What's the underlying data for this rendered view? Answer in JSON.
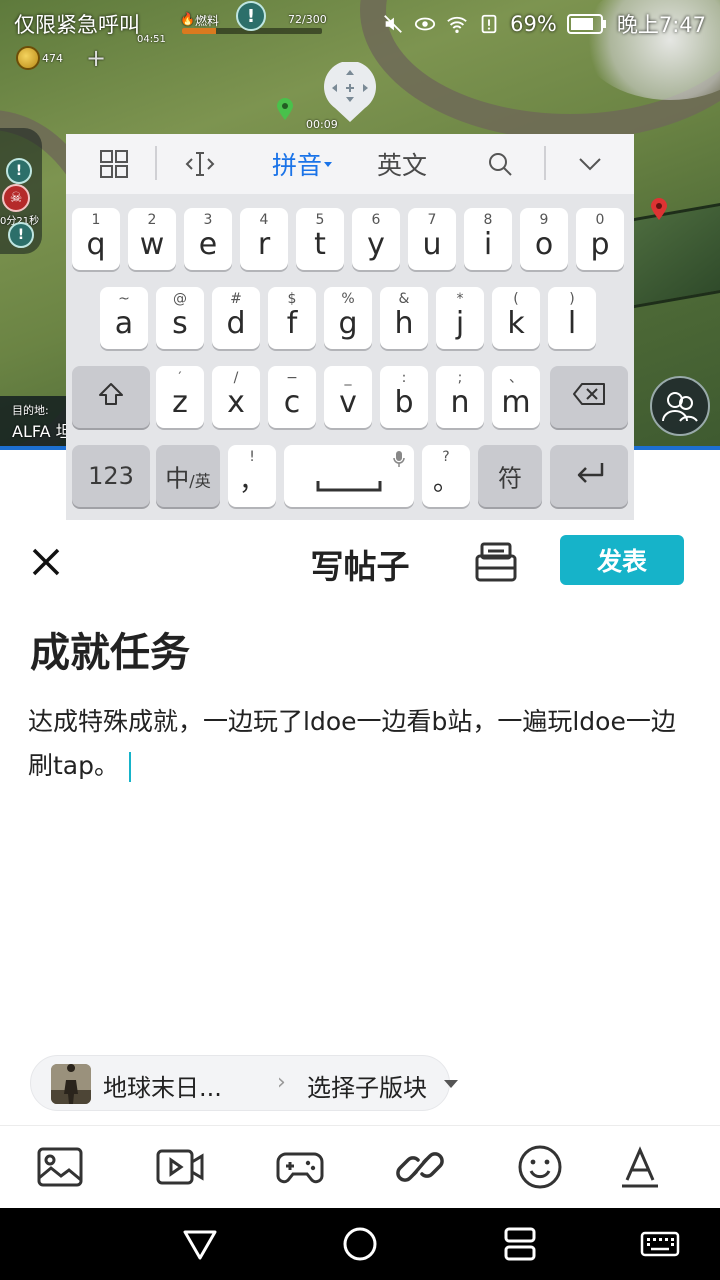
{
  "status_bar": {
    "left_text": "仅限紧急呼叫",
    "battery": "69%",
    "time": "晚上7:47"
  },
  "game_hud": {
    "fuel_label": "燃料",
    "fuel_value": "72/300",
    "fuel_fraction": 0.24,
    "timer_top": "04:51",
    "coins": "474",
    "timer_marker": "00:09",
    "left_timer": "0分21秒",
    "destination_label": "目的地:",
    "destination_value": "ALFA 坦"
  },
  "keyboard": {
    "toolbar": {
      "grid_icon": "grid-icon",
      "cursor_icon": "cursor-move-icon",
      "pinyin_label": "拼音",
      "english_label": "英文",
      "search_icon": "search-icon",
      "collapse_icon": "chevron-down-icon",
      "active_color": "#1a73e8"
    },
    "row1": [
      {
        "hint": "1",
        "key": "q"
      },
      {
        "hint": "2",
        "key": "w"
      },
      {
        "hint": "3",
        "key": "e"
      },
      {
        "hint": "4",
        "key": "r"
      },
      {
        "hint": "5",
        "key": "t"
      },
      {
        "hint": "6",
        "key": "y"
      },
      {
        "hint": "7",
        "key": "u"
      },
      {
        "hint": "8",
        "key": "i"
      },
      {
        "hint": "9",
        "key": "o"
      },
      {
        "hint": "0",
        "key": "p"
      }
    ],
    "row2": [
      {
        "hint": "~",
        "key": "a"
      },
      {
        "hint": "@",
        "key": "s"
      },
      {
        "hint": "#",
        "key": "d"
      },
      {
        "hint": "$",
        "key": "f"
      },
      {
        "hint": "%",
        "key": "g"
      },
      {
        "hint": "&",
        "key": "h"
      },
      {
        "hint": "*",
        "key": "j"
      },
      {
        "hint": "(",
        "key": "k"
      },
      {
        "hint": ")",
        "key": "l"
      }
    ],
    "row3": [
      {
        "hint": "′",
        "key": "z"
      },
      {
        "hint": "/",
        "key": "x"
      },
      {
        "hint": "−",
        "key": "c"
      },
      {
        "hint": "_",
        "key": "v"
      },
      {
        "hint": ":",
        "key": "b"
      },
      {
        "hint": ";",
        "key": "n"
      },
      {
        "hint": "、",
        "key": "m"
      }
    ],
    "row4": {
      "numbers": "123",
      "lang_main": "中",
      "lang_sub": "/英",
      "comma_hint": "!",
      "comma": "，",
      "period_hint": "?",
      "period": "。",
      "symbols": "符"
    }
  },
  "editor": {
    "title": "写帖子",
    "publish_label": "发表",
    "accent_color": "#16b3c9",
    "post_title": "成就任务",
    "post_body": "达成特殊成就，一边玩了ldoe一边看b站，一遍玩ldoe一边刷tap。",
    "board": {
      "game_name": "地球末日...",
      "sub_board": "选择子版块"
    }
  },
  "toolbar_icons": [
    "image-icon",
    "video-icon",
    "gamepad-icon",
    "link-icon",
    "emoji-icon",
    "text-format-icon"
  ],
  "nav_icons": [
    "back-icon",
    "home-icon",
    "recents-icon",
    "keyboard-icon"
  ]
}
